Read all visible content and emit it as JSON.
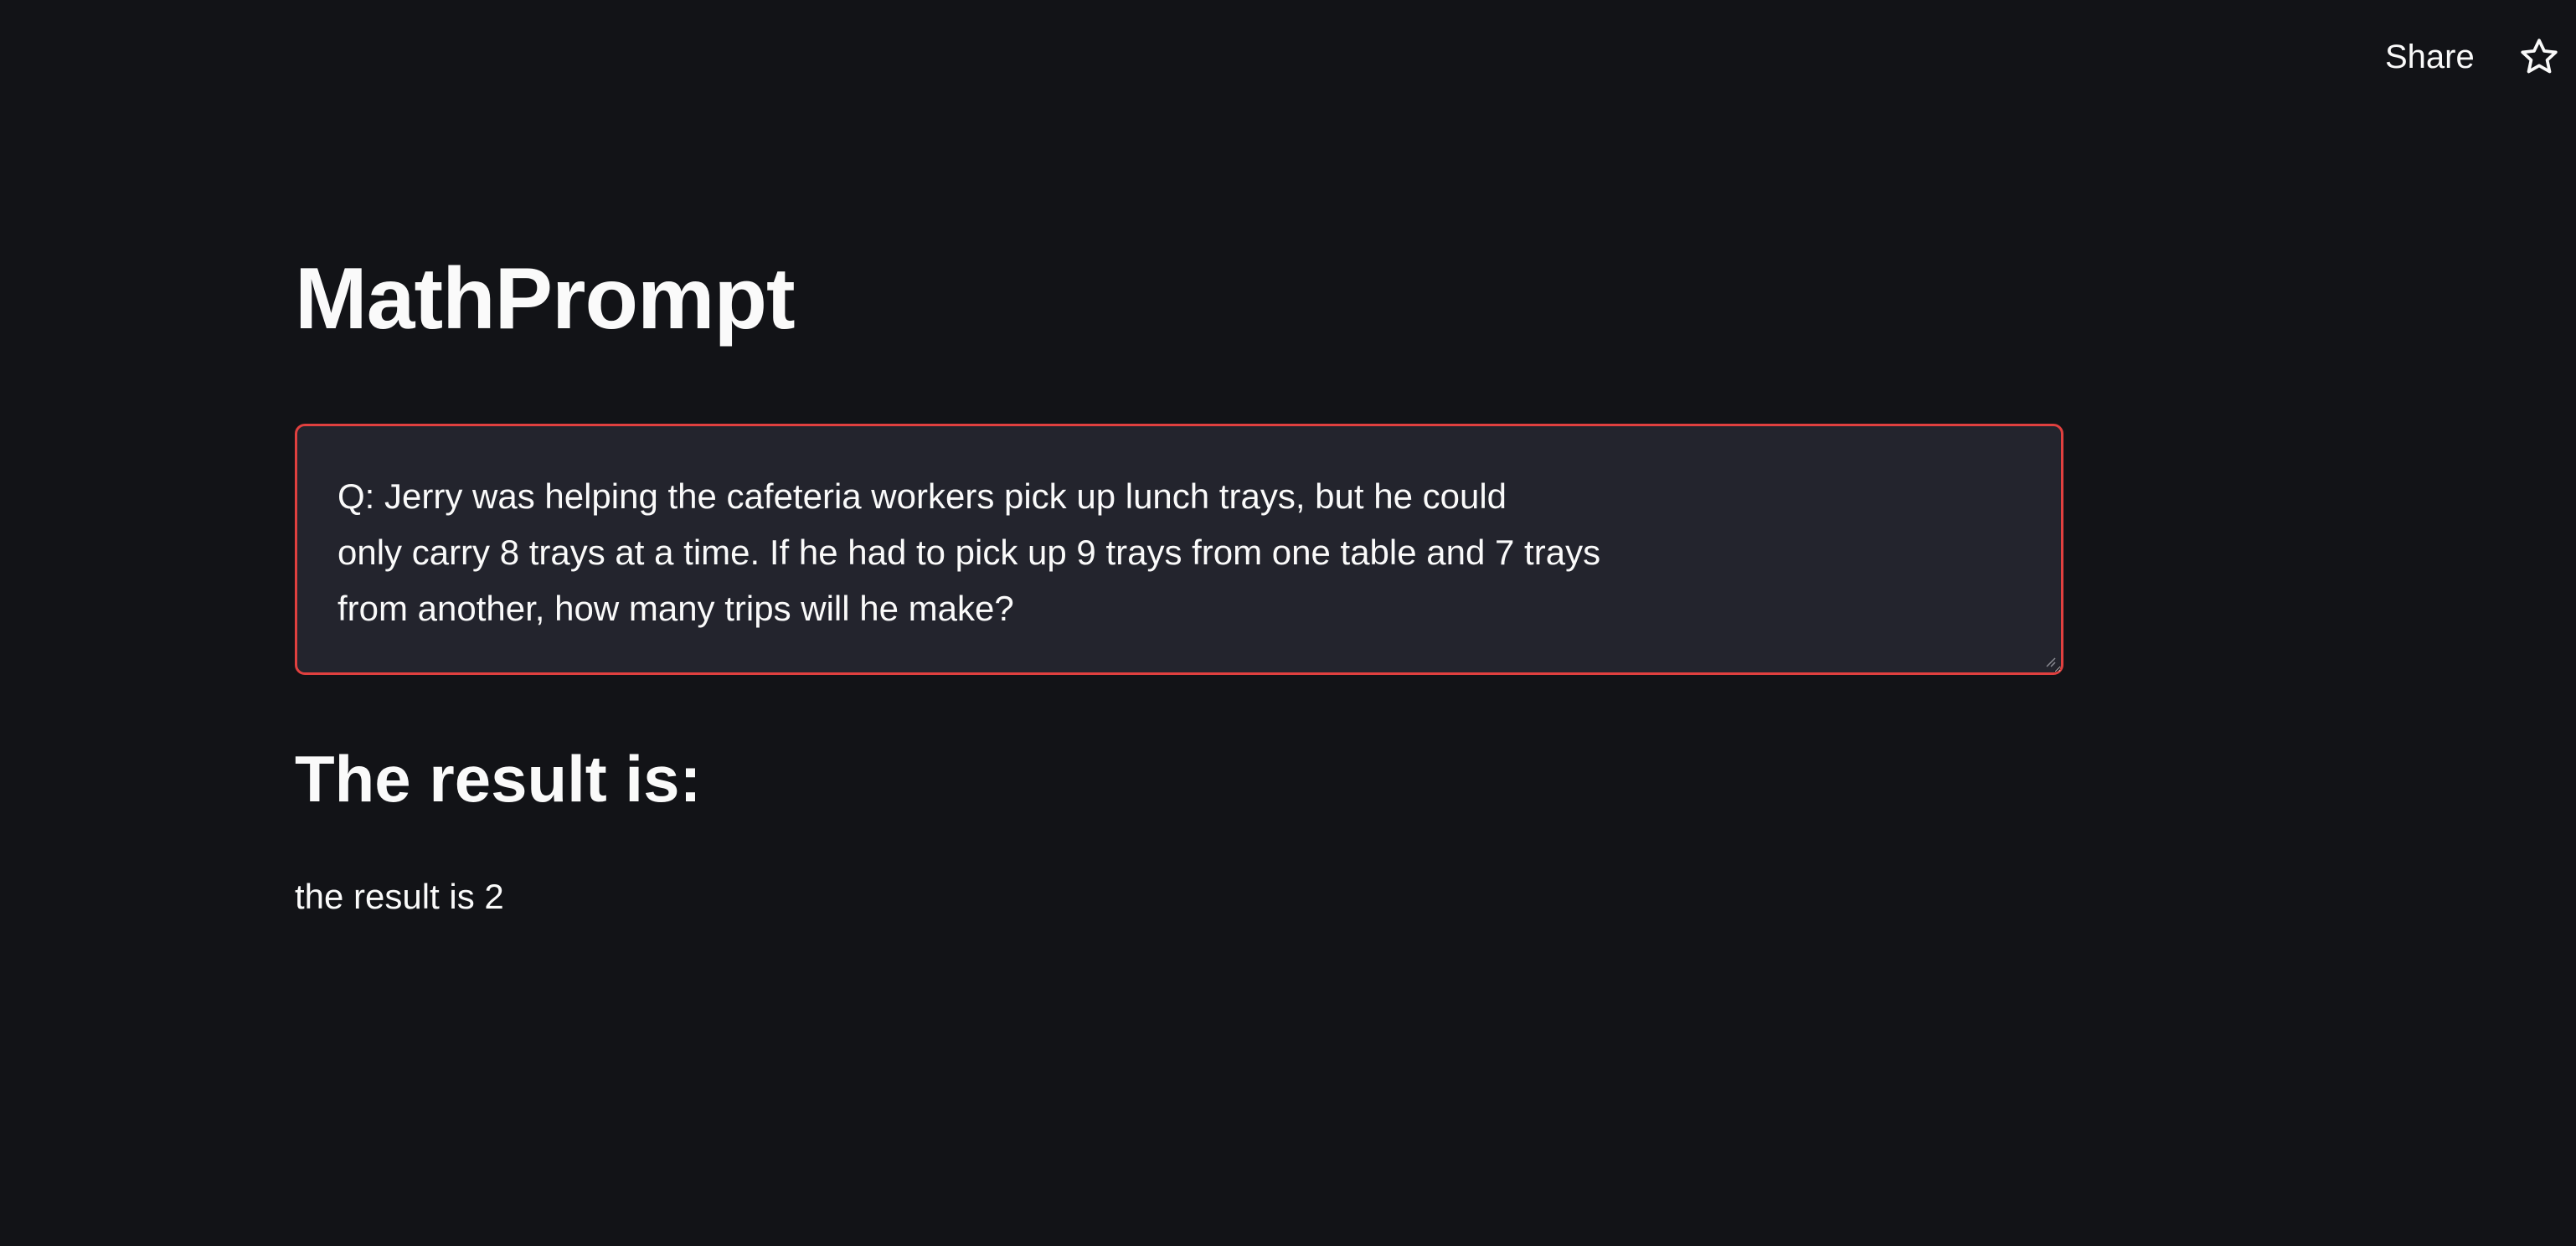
{
  "header": {
    "share_label": "Share",
    "star_icon": "star-icon"
  },
  "main": {
    "title": "MathPrompt",
    "question": {
      "value": "Q: Jerry was helping the cafeteria workers pick up lunch trays, but he could\nonly carry 8 trays at a time. If he had to pick up 9 trays from one table and 7 trays\nfrom another, how many trips will he make?",
      "border_color": "#e0403f"
    },
    "result_heading": "The result is:",
    "result_text": "the result is 2"
  },
  "colors": {
    "background": "#121317",
    "input_background": "#23242d",
    "text": "#fafafa",
    "accent": "#e0403f"
  }
}
